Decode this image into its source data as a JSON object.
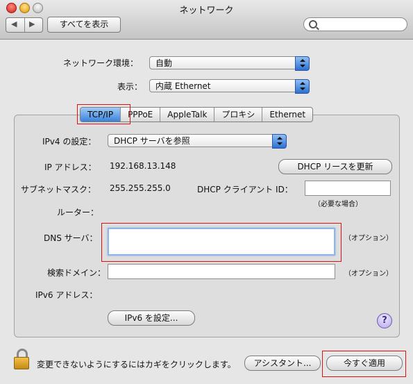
{
  "window": {
    "title": "ネットワーク"
  },
  "toolbar": {
    "back_glyph": "◀",
    "forward_glyph": "▶",
    "show_all_label": "すべてを表示",
    "search_placeholder": ""
  },
  "top": {
    "location_label": "ネットワーク環境：",
    "location_value": "自動",
    "show_label": "表示：",
    "show_value": "内蔵 Ethernet"
  },
  "tabs": [
    {
      "label": "TCP/IP",
      "selected": true
    },
    {
      "label": "PPPoE",
      "selected": false
    },
    {
      "label": "AppleTalk",
      "selected": false
    },
    {
      "label": "プロキシ",
      "selected": false
    },
    {
      "label": "Ethernet",
      "selected": false
    }
  ],
  "tcpip": {
    "ipv4_config_label": "IPv4 の設定：",
    "ipv4_config_value": "DHCP サーバを参照",
    "ip_address_label": "IP アドレス：",
    "ip_address_value": "192.168.13.148",
    "renew_button": "DHCP リースを更新",
    "subnet_label": "サブネットマスク：",
    "subnet_value": "255.255.255.0",
    "dhcp_client_id_label": "DHCP クライアント ID：",
    "dhcp_client_id_value": "",
    "required_note": "（必要な場合）",
    "router_label": "ルーター：",
    "router_value": "",
    "dns_label": "DNS サーバ：",
    "dns_value": "",
    "optional_note_dns": "（オプション）",
    "search_domain_label": "検索ドメイン：",
    "search_domain_value": "",
    "optional_note_search": "（オプション）",
    "ipv6_label": "IPv6 アドレス：",
    "ipv6_button": "IPv6 を設定..."
  },
  "help_glyph": "?",
  "footer": {
    "lock_text": "変更できないようにするにはカギをクリックします。",
    "assistant_button": "アシスタント...",
    "apply_button": "今すぐ適用"
  },
  "colors": {
    "highlight_box": "#dd1111",
    "tab_selected": "#3a83da",
    "popup_arrow": "#2d6fd0"
  },
  "icons": [
    "back-arrow-icon",
    "forward-arrow-icon",
    "search-icon",
    "popup-arrows-icon",
    "help-icon",
    "lock-icon"
  ]
}
